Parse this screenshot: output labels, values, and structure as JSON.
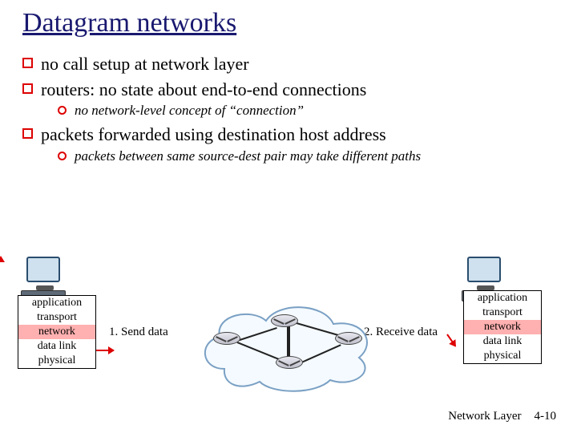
{
  "title": "Datagram networks",
  "bullets": [
    {
      "text": "no call setup at network layer"
    },
    {
      "text": "routers: no state about end-to-end connections",
      "sub": [
        "no network-level concept of “connection”"
      ]
    },
    {
      "text": "packets forwarded using destination host address",
      "sub": [
        "packets between same source-dest pair may take different paths"
      ]
    }
  ],
  "stack_left": [
    "application",
    "transport",
    "network",
    "data link",
    "physical"
  ],
  "stack_right": [
    "application",
    "transport",
    "network",
    "data link",
    "physical"
  ],
  "highlight_layer": "network",
  "captions": {
    "send": "1. Send data",
    "recv": "2. Receive data"
  },
  "footer": {
    "section": "Network Layer",
    "page": "4-10"
  }
}
